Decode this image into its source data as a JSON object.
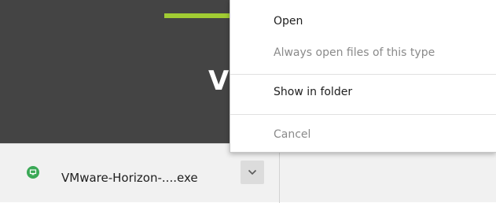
{
  "context_menu": {
    "items": [
      {
        "label": "Open",
        "enabled": true
      },
      {
        "label": "Always open files of this type",
        "enabled": false
      },
      {
        "label": "Show in folder",
        "enabled": true
      },
      {
        "label": "Cancel",
        "enabled": false
      }
    ]
  },
  "download_shelf": {
    "item": {
      "file_name": "VMware-Horizon-....exe",
      "icon": "installer-icon",
      "menu_button_icon": "chevron-down-icon"
    }
  },
  "page": {
    "visible_letter": "V"
  },
  "colors": {
    "page_background": "#444444",
    "accent": "#a1cc33",
    "file_icon": "#3aa856"
  }
}
